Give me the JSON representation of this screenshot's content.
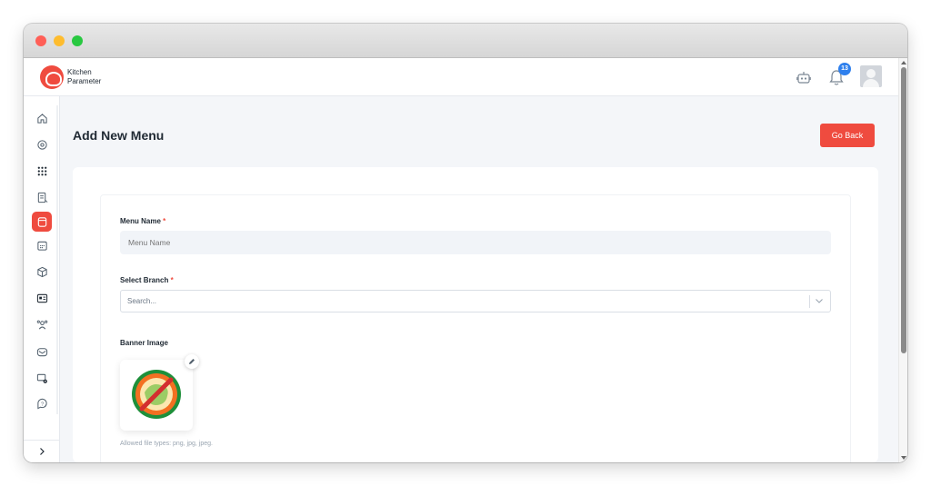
{
  "brand": {
    "line1": "Kitchen",
    "line2": "Parameter"
  },
  "header": {
    "notification_count": "13"
  },
  "page": {
    "title": "Add New Menu",
    "go_back_label": "Go Back"
  },
  "form": {
    "menu_name": {
      "label": "Menu Name",
      "required_mark": "*",
      "placeholder": "Menu Name"
    },
    "branch": {
      "label": "Select Branch",
      "required_mark": "*",
      "placeholder": "Search..."
    },
    "banner": {
      "label": "Banner Image",
      "hint": "Allowed file types: png, jpg, jpeg."
    }
  },
  "sidebar": {
    "items": [
      {
        "icon": "home-icon"
      },
      {
        "icon": "location-icon"
      },
      {
        "icon": "grid-dots-icon"
      },
      {
        "icon": "receipt-icon"
      },
      {
        "icon": "menu-book-icon",
        "active": true
      },
      {
        "icon": "calendar-icon"
      },
      {
        "icon": "box-icon"
      },
      {
        "icon": "dashboard-icon"
      },
      {
        "icon": "users-icon"
      },
      {
        "icon": "mail-icon"
      },
      {
        "icon": "settings-card-icon"
      },
      {
        "icon": "help-icon"
      }
    ],
    "expand_icon": "chevron-right-icon"
  },
  "colors": {
    "accent": "#ef4b3f",
    "badge": "#2f80ed",
    "page_bg": "#f4f6f9",
    "input_bg": "#f1f4f8"
  }
}
